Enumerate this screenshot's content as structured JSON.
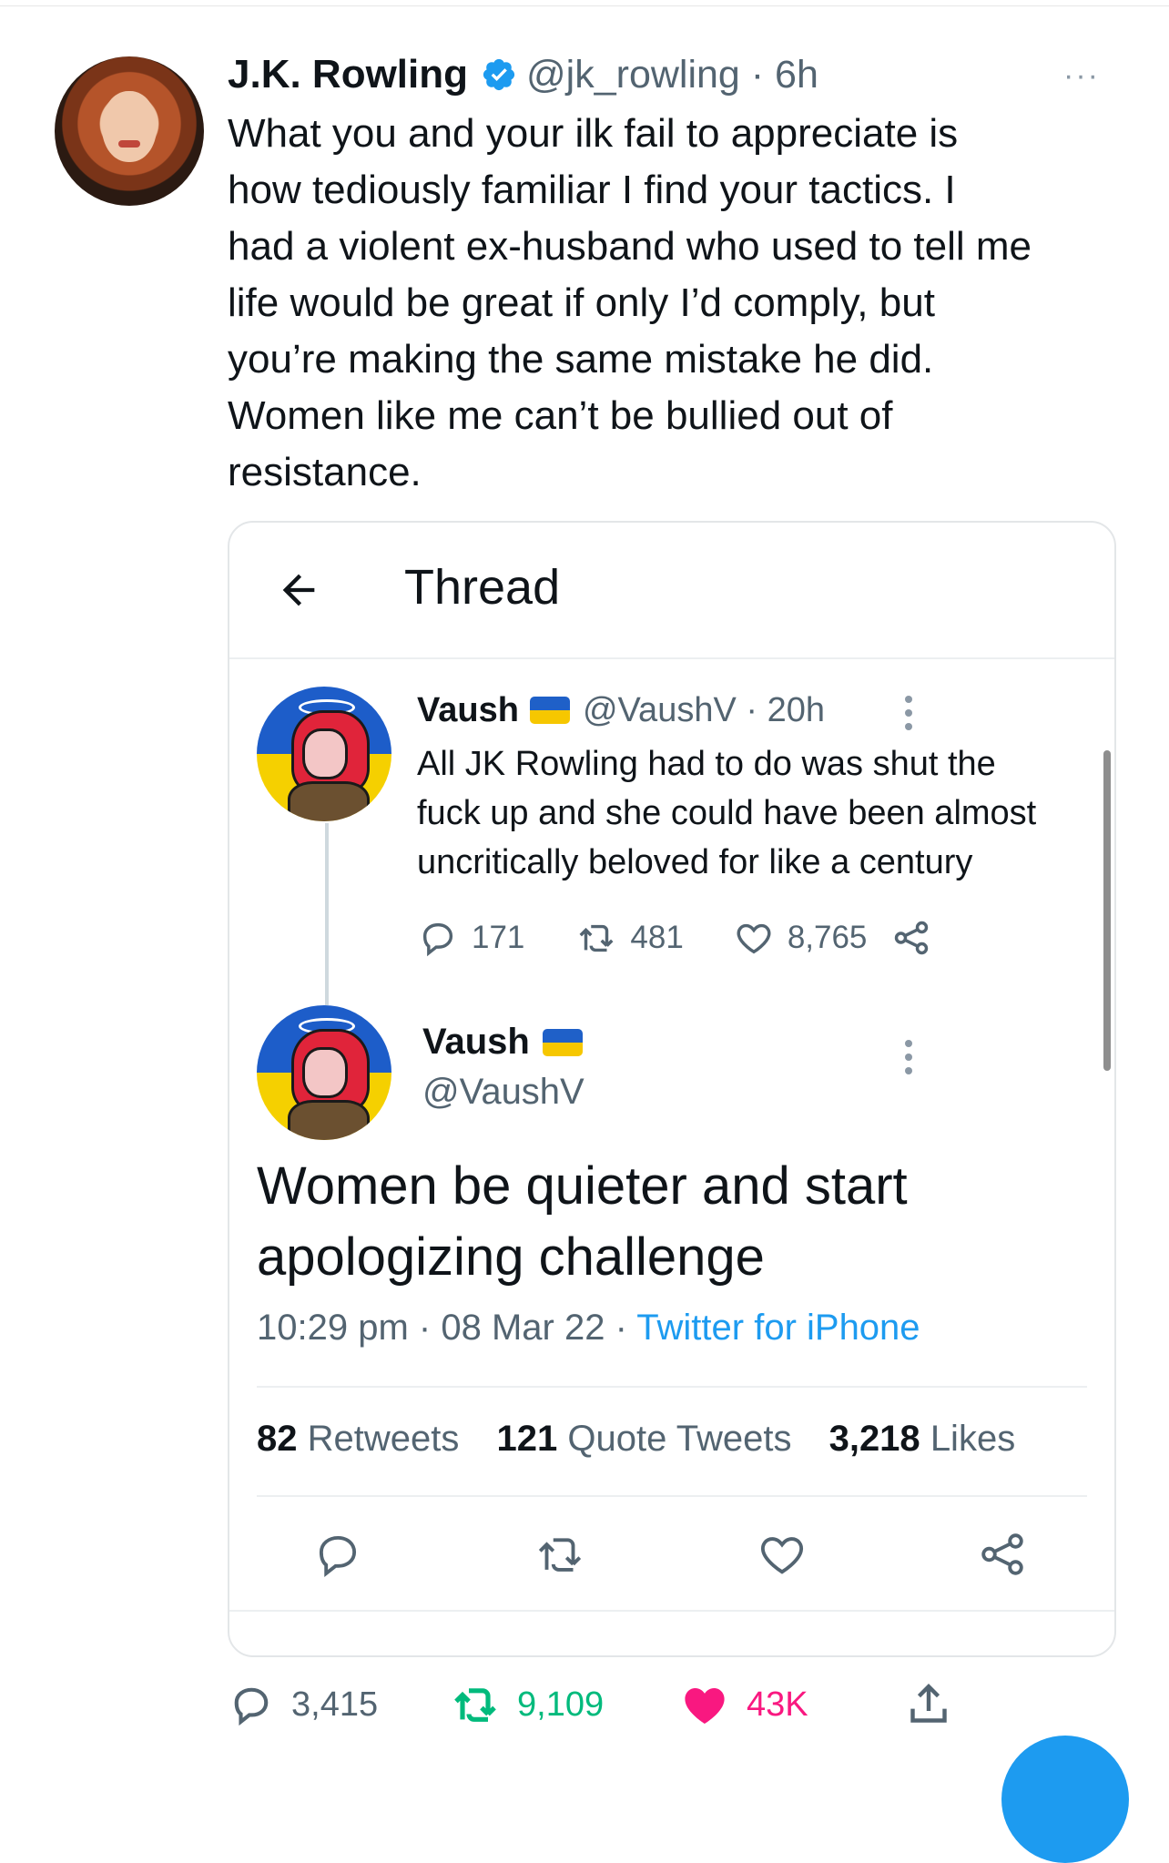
{
  "tweet": {
    "author_name": "J.K. Rowling",
    "handle_time": "@jk_rowling · 6h",
    "more": "···",
    "text_lines": [
      "What you and your ilk fail to appreciate is",
      "how tediously familiar I find your tactics. I",
      "had a violent ex-husband who used to tell me",
      "life would be great if only I’d comply, but",
      "you’re making the same mistake he did.",
      "Women like me can’t be bullied out of",
      "resistance."
    ],
    "stats": {
      "replies": "3,415",
      "retweets": "9,109",
      "likes": "43K"
    },
    "colors": {
      "like": "#f91880",
      "retweet": "#00ba7c",
      "verified": "#1d9bf0"
    }
  },
  "embedded": {
    "header_title": "Thread",
    "reply": {
      "name": "Vaush",
      "handle_time": "@VaushV · 20h",
      "text_lines": [
        "All JK Rowling had to do was shut the",
        "fuck up and she could have been almost",
        "uncritically beloved for like a century"
      ],
      "replies": "171",
      "retweets": "481",
      "likes": "8,765"
    },
    "main": {
      "name": "Vaush",
      "handle": "@VaushV",
      "text_lines": [
        "Women be quieter and start",
        "apologizing challenge"
      ],
      "time": "10:29 pm",
      "date": "08 Mar 22",
      "source": "Twitter for iPhone",
      "retweets_count": "82",
      "retweets_label": "Retweets",
      "quotes_count": "121",
      "quotes_label": "Quote Tweets",
      "likes_count": "3,218",
      "likes_label": "Likes"
    }
  }
}
